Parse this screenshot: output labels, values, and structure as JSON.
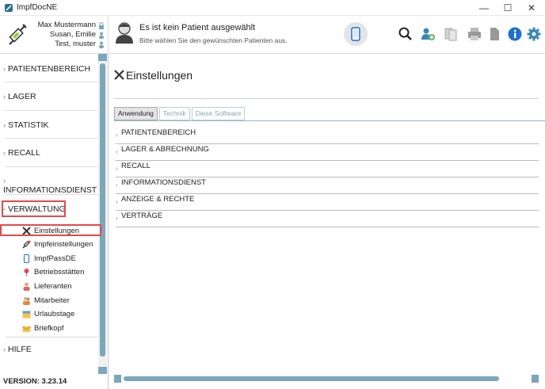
{
  "window": {
    "title": "ImpfDocNE",
    "minimize": "—",
    "maximize": "☐",
    "close": "✕"
  },
  "header": {
    "users": [
      "Max Mustermann",
      "Susan, Emilie",
      "Test, muster"
    ],
    "patient_title": "Es ist kein Patient ausgewählt",
    "patient_subtitle": "Bitte wählen Sie den gewünschten Patienten aus.",
    "toolbar_icons": [
      "search-icon",
      "user-add-icon",
      "documents-icon",
      "printer-icon",
      "document-icon",
      "info-icon",
      "gear-icon"
    ]
  },
  "sidebar": {
    "sections": [
      {
        "label": "PATIENTENBEREICH"
      },
      {
        "label": "LAGER"
      },
      {
        "label": "STATISTIK"
      },
      {
        "label": "RECALL"
      },
      {
        "label": "INFORMATIONSDIENST"
      },
      {
        "label": "VERWALTUNG"
      },
      {
        "label": "HILFE"
      }
    ],
    "verwaltung_items": [
      {
        "label": "Einstellungen",
        "icon": "wrench-icon"
      },
      {
        "label": "Impfeinstellungen",
        "icon": "syringe-icon"
      },
      {
        "label": "ImpfPassDE",
        "icon": "phone-icon"
      },
      {
        "label": "Betriebsstätten",
        "icon": "map-pin-icon"
      },
      {
        "label": "Lieferanten",
        "icon": "supplier-icon"
      },
      {
        "label": "Mitarbeiter",
        "icon": "staff-icon"
      },
      {
        "label": "Urlaubstage",
        "icon": "calendar-icon"
      },
      {
        "label": "Briefkopf",
        "icon": "letterhead-icon"
      }
    ],
    "version": "VERSION: 3.23.14"
  },
  "main": {
    "title": "Einstellungen",
    "tabs": [
      {
        "label": "Anwendung",
        "active": true
      },
      {
        "label": "Technik",
        "active": false
      },
      {
        "label": "Diese Software",
        "active": false
      }
    ],
    "accordion": [
      {
        "label": "PATIENTENBEREICH"
      },
      {
        "label": "LAGER & ABRECHNUNG"
      },
      {
        "label": "RECALL"
      },
      {
        "label": "INFORMATIONSDIENST"
      },
      {
        "label": "ANZEIGE & RECHTE"
      },
      {
        "label": "VERTRÄGE"
      }
    ]
  },
  "colors": {
    "accent": "#7aa7bd",
    "highlight_border": "#e24a4a",
    "info_blue": "#1e6fd0",
    "gear_blue": "#3b86b5"
  }
}
